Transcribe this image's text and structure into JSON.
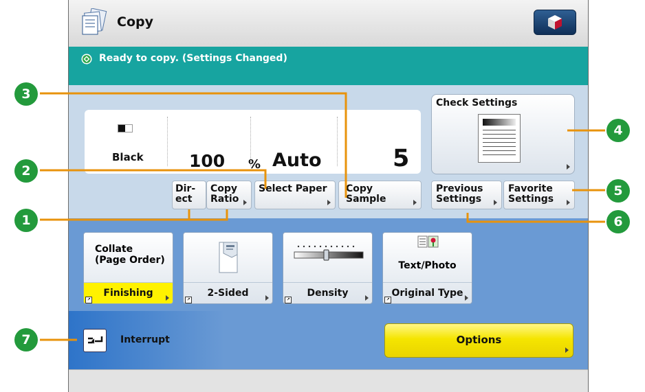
{
  "app": {
    "title": "Copy",
    "icon": "copy-documents-icon",
    "menu_icon": "cube-menu-icon"
  },
  "status": {
    "text": "Ready to copy. (Settings Changed)",
    "icon": "ready-indicator-icon"
  },
  "current_settings": {
    "color_mode": "Black",
    "ratio_value": "100",
    "ratio_unit": "%",
    "paper": "Auto",
    "quantity": "5"
  },
  "buttons": {
    "direct": "Dir-\nect",
    "copy_ratio": "Copy\nRatio",
    "select_paper": "Select Paper",
    "copy_sample": "Copy\nSample",
    "check_settings": "Check Settings",
    "previous_settings": "Previous\nSettings",
    "favorite_settings": "Favorite\nSettings"
  },
  "functions": [
    {
      "top_label": "Collate\n(Page Order)",
      "bottom_label": "Finishing",
      "highlighted": true
    },
    {
      "top_label": "",
      "icon": "two-sided-page-icon",
      "bottom_label": "2-Sided",
      "highlighted": false
    },
    {
      "top_label": "",
      "icon": "density-slider-icon",
      "bottom_label": "Density",
      "highlighted": false
    },
    {
      "top_label": "Text/Photo",
      "icon": "text-photo-icon",
      "bottom_label": "Original Type",
      "highlighted": false
    }
  ],
  "interrupt": {
    "label": "Interrupt",
    "icon": "interrupt-icon"
  },
  "options": {
    "label": "Options"
  },
  "callouts": [
    "1",
    "2",
    "3",
    "4",
    "5",
    "6",
    "7"
  ],
  "colors": {
    "callout": "#239a3c",
    "leader": "#e8930c",
    "status_bar": "#17a4a0",
    "highlight": "#fff200",
    "options": "#f5e500"
  }
}
